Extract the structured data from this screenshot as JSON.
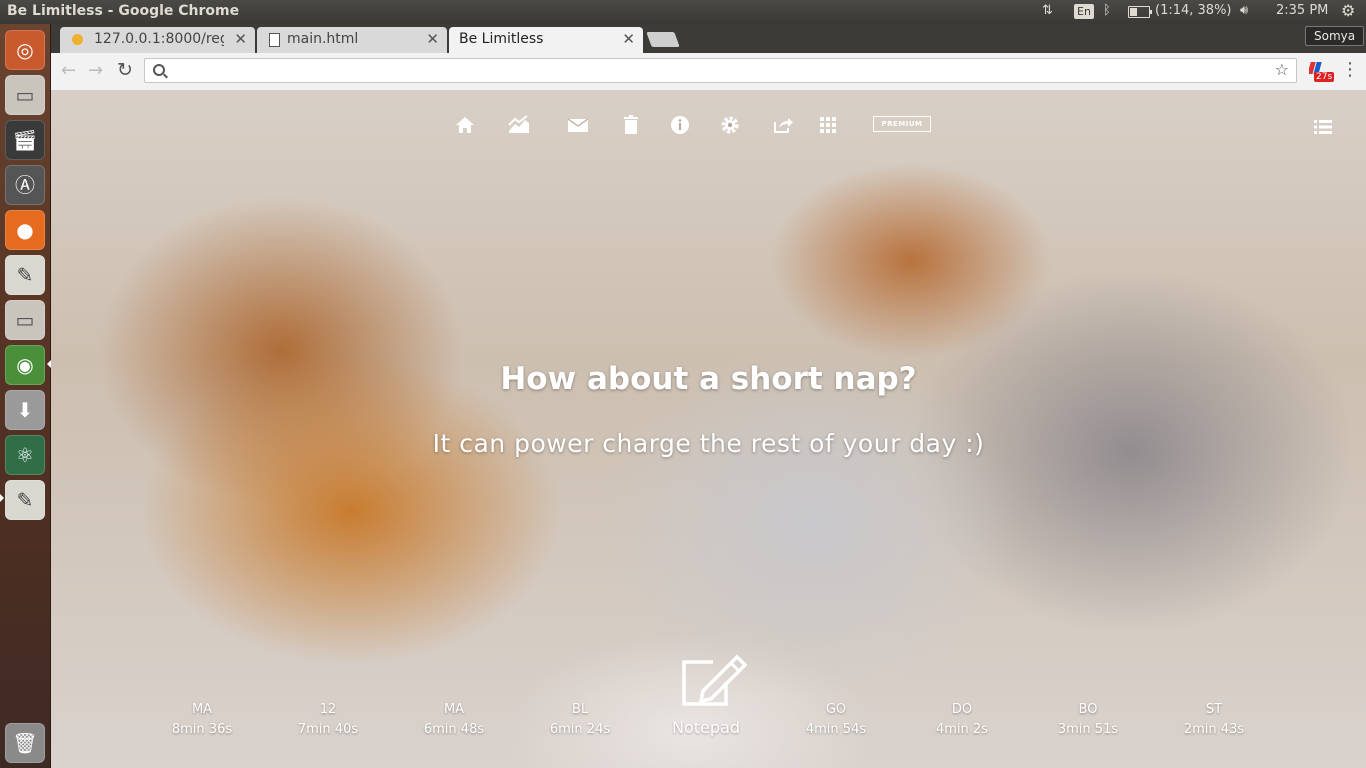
{
  "window": {
    "title": "Be Limitless - Google Chrome"
  },
  "system_tray": {
    "keyboard_layout": "En",
    "battery_text": "(1:14, 38%)",
    "battery_level_percent": 38,
    "clock": "2:35 PM",
    "user_name": "Somya",
    "icons": [
      "network-updown-icon",
      "bluetooth-icon",
      "battery-icon",
      "volume-icon",
      "gear-icon"
    ]
  },
  "launcher": {
    "items": [
      {
        "name": "ubuntu-dash",
        "icon": "ubuntu-logo-icon"
      },
      {
        "name": "files",
        "icon": "file-manager-icon"
      },
      {
        "name": "video-editor",
        "icon": "clapperboard-icon"
      },
      {
        "name": "software-updater",
        "icon": "updater-icon"
      },
      {
        "name": "firefox",
        "icon": "firefox-icon"
      },
      {
        "name": "text-editor",
        "icon": "text-editor-icon"
      },
      {
        "name": "files-2",
        "icon": "file-manager-icon"
      },
      {
        "name": "chrome",
        "icon": "chrome-icon"
      },
      {
        "name": "installer",
        "icon": "download-icon"
      },
      {
        "name": "atom",
        "icon": "atom-icon"
      },
      {
        "name": "text-editor-2",
        "icon": "text-editor-icon"
      },
      {
        "name": "trash",
        "icon": "trash-icon"
      }
    ]
  },
  "tabs": [
    {
      "label": "127.0.0.1:8000/regi",
      "icon": "user-favicon-icon",
      "active": false
    },
    {
      "label": "main.html",
      "icon": "document-icon",
      "active": false
    },
    {
      "label": "Be Limitless",
      "icon": "",
      "active": true
    }
  ],
  "toolbar": {
    "url_value": "",
    "extension_badge": "27s"
  },
  "page": {
    "nav_icons": [
      "home-icon",
      "chart-icon",
      "mail-icon",
      "trash-icon",
      "info-icon",
      "gear-icon",
      "share-icon",
      "apps-grid-icon"
    ],
    "premium_label": "PREMIUM",
    "headline": "How about a short nap?",
    "subline": "It can power charge the rest of your day :)",
    "notepad_label": "Notepad",
    "stats": [
      {
        "code": "MA",
        "time": "8min 36s"
      },
      {
        "code": "12",
        "time": "7min 40s"
      },
      {
        "code": "MA",
        "time": "6min 48s"
      },
      {
        "code": "BL",
        "time": "6min 24s"
      },
      {
        "code": "GO",
        "time": "4min 54s"
      },
      {
        "code": "DO",
        "time": "4min 2s"
      },
      {
        "code": "BO",
        "time": "3min 51s"
      },
      {
        "code": "ST",
        "time": "2min 43s"
      }
    ]
  }
}
